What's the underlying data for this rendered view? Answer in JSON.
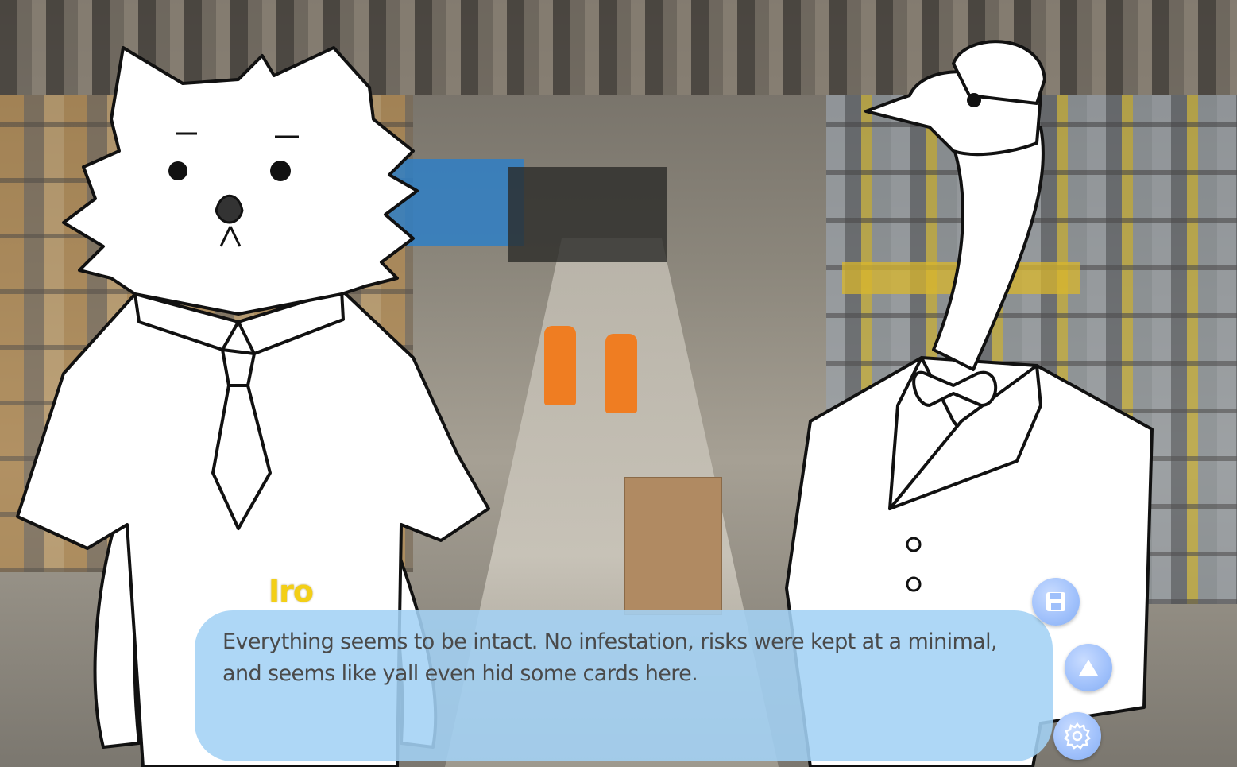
{
  "dialogue": {
    "speaker": "Iro",
    "text": "Everything seems to be intact. No infestation, risks were kept at a minimal, and seems like yall even hid some cards here."
  },
  "characters": {
    "left": "cat-character-white-shirt-tie",
    "right": "goose-character-white-suit-bowtie-cap"
  },
  "background": {
    "scene": "warehouse-interior"
  },
  "controls": {
    "save_icon": "floppy-disk-icon",
    "history_icon": "triangle-up-icon",
    "settings_icon": "gear-icon"
  },
  "colors": {
    "speaker_name": "#f3cf16",
    "dialogue_box": "#a3d2f5",
    "dialogue_text": "#4a4a4a",
    "button_fill": "#9fc0fb"
  }
}
